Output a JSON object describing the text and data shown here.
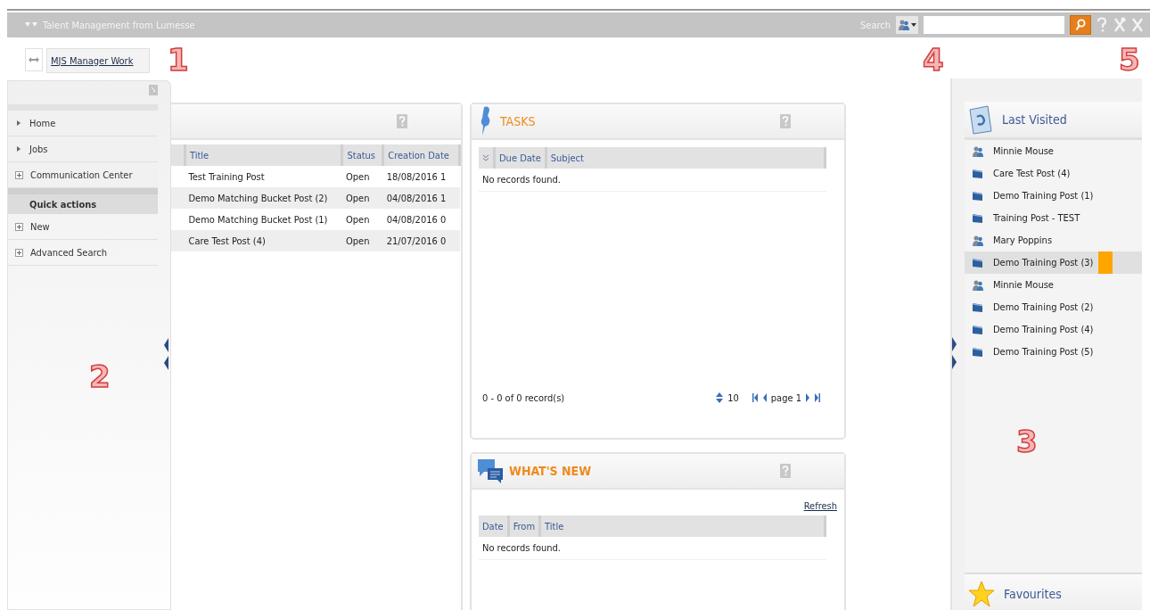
{
  "header": {
    "title": "Talent Management from Lumesse",
    "search_label": "Search"
  },
  "toolbar": {
    "workspace": "MJS Manager Work"
  },
  "sidebar": {
    "items": [
      {
        "label": "Home",
        "kind": "arrow"
      },
      {
        "label": "Jobs",
        "kind": "arrow"
      },
      {
        "label": "Communication Center",
        "kind": "plus"
      }
    ],
    "section_title": "Quick actions",
    "actions": [
      {
        "label": "New",
        "kind": "plus"
      },
      {
        "label": "Advanced Search",
        "kind": "plus"
      }
    ]
  },
  "jobs": {
    "columns": [
      "Title",
      "Status",
      "Creation Date"
    ],
    "rows": [
      [
        "Test Training Post",
        "Open",
        "18/08/2016 1"
      ],
      [
        "Demo Matching Bucket Post (2)",
        "Open",
        "04/08/2016 1"
      ],
      [
        "Demo Matching Bucket Post (1)",
        "Open",
        "04/08/2016 0"
      ],
      [
        "Care Test Post (4)",
        "Open",
        "21/07/2016 0"
      ]
    ]
  },
  "tasks": {
    "title": "TASKS",
    "columns": [
      "Due Date",
      "Subject"
    ],
    "empty": "No records found.",
    "summary": "0 - 0 of 0 record(s)",
    "page_size": "10",
    "page": "page 1"
  },
  "whats_new": {
    "title": "WHAT'S NEW",
    "refresh": "Refresh",
    "columns": [
      "Date",
      "From",
      "Title"
    ],
    "empty": "No records found."
  },
  "last_visited": {
    "title": "Last Visited",
    "items": [
      {
        "label": "Minnie Mouse",
        "kind": "person",
        "selected": false
      },
      {
        "label": "Care Test Post (4)",
        "kind": "post",
        "selected": false
      },
      {
        "label": "Demo Training Post (1)",
        "kind": "post",
        "selected": false
      },
      {
        "label": "Training Post - TEST",
        "kind": "post",
        "selected": false
      },
      {
        "label": "Mary Poppins",
        "kind": "person",
        "selected": false
      },
      {
        "label": "Demo Training Post (3)",
        "kind": "post",
        "selected": true
      },
      {
        "label": "Minnie Mouse",
        "kind": "person",
        "selected": false
      },
      {
        "label": "Demo Training Post (2)",
        "kind": "post",
        "selected": false
      },
      {
        "label": "Demo Training Post (4)",
        "kind": "post",
        "selected": false
      },
      {
        "label": "Demo Training Post (5)",
        "kind": "post",
        "selected": false
      }
    ]
  },
  "favourites": {
    "title": "Favourites"
  },
  "callouts": [
    "1",
    "2",
    "3",
    "4",
    "5"
  ]
}
